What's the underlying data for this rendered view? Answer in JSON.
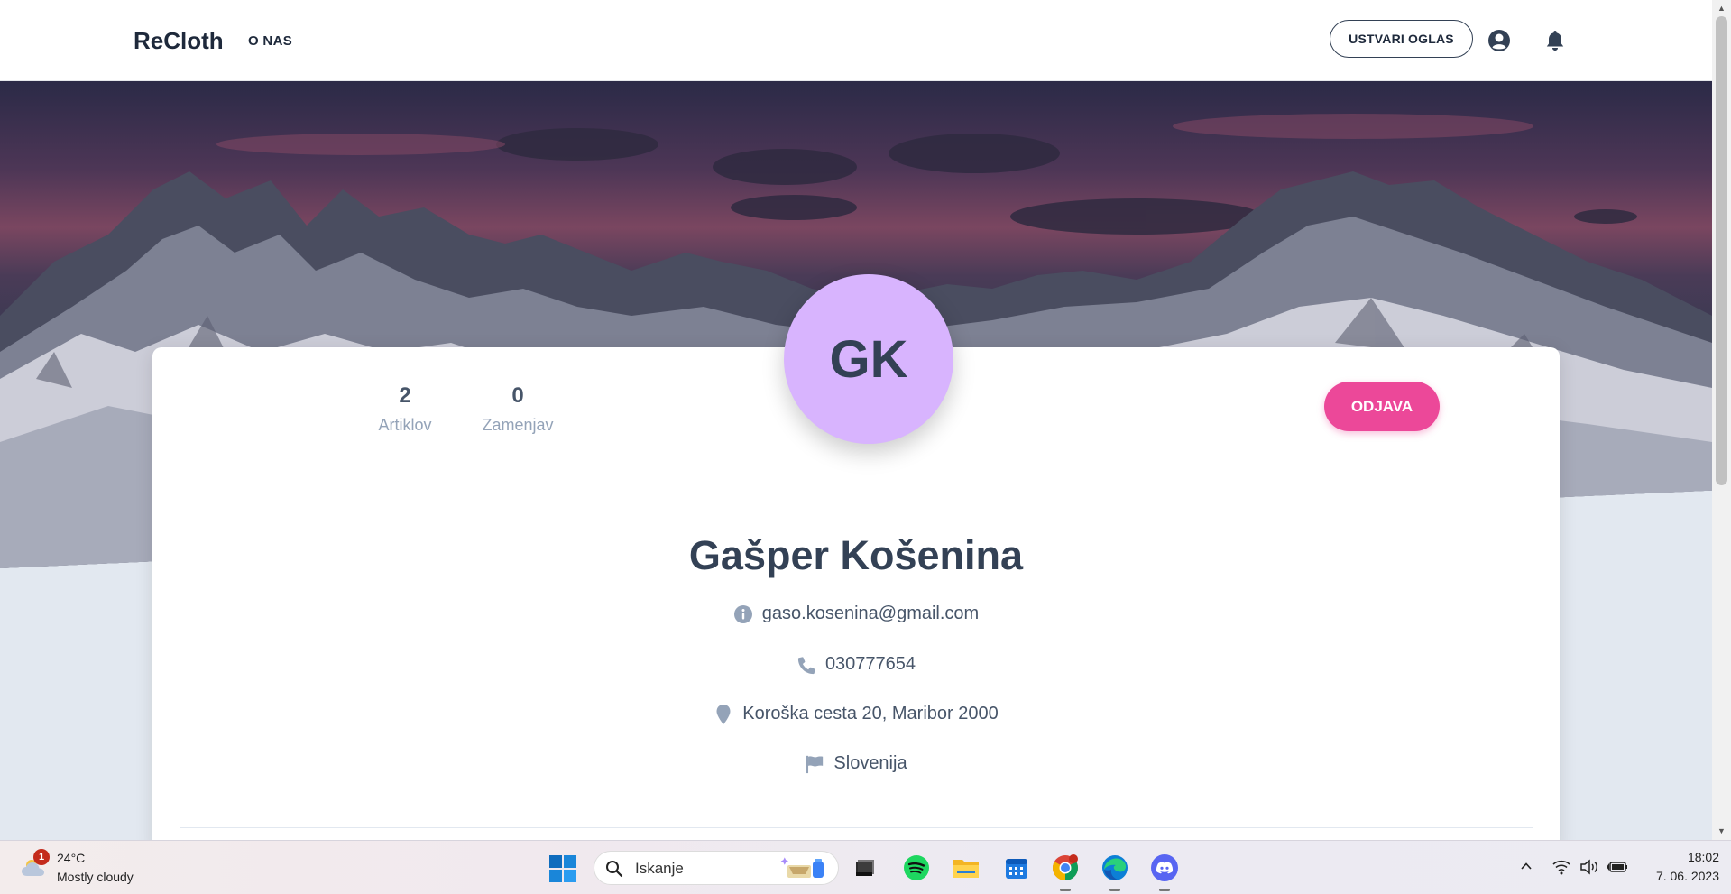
{
  "nav": {
    "brand": "ReCloth",
    "about_link": "O NAS",
    "create_ad_button": "USTVARI OGLAS",
    "icons": [
      "user-circle-icon",
      "bell-icon"
    ]
  },
  "profile": {
    "initials": "GK",
    "stats": [
      {
        "value": "2",
        "label": "Artiklov"
      },
      {
        "value": "0",
        "label": "Zamenjav"
      }
    ],
    "logout_button": "ODJAVA",
    "name": "Gašper Košenina",
    "email": "gaso.kosenina@gmail.com",
    "phone": "030777654",
    "address": "Koroška cesta 20, Maribor 2000",
    "country": "Slovenija",
    "info_icons": [
      "info-circle-icon",
      "phone-icon",
      "map-marker-icon",
      "flag-icon"
    ]
  },
  "colors": {
    "accent_pink": "#ec4899",
    "avatar_bg": "#d8b4fe",
    "text_dark": "#334155",
    "page_bg": "#e2e8f0"
  },
  "taskbar": {
    "weather": {
      "badge": "1",
      "temp": "24°C",
      "desc": "Mostly cloudy"
    },
    "search_placeholder": "Iskanje",
    "apps": [
      "file-explorer-icon-dark",
      "spotify-icon",
      "folder-icon",
      "calendar-icon",
      "chrome-icon",
      "edge-icon",
      "discord-icon"
    ],
    "clock_time": "18:02",
    "clock_date": "7. 06. 2023"
  }
}
